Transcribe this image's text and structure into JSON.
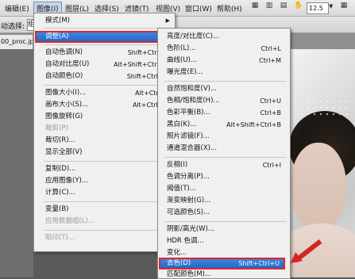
{
  "menubar": {
    "items": [
      "编辑(E)",
      "图像(I)",
      "图层(L)",
      "选择(S)",
      "滤镜(T)",
      "视图(V)",
      "窗口(W)",
      "帮助(H)"
    ],
    "zoom": "12.5"
  },
  "options": {
    "label": "动选择:",
    "select_value": "组"
  },
  "document": {
    "tab": "00_proc.jpg"
  },
  "image_menu": [
    {
      "label": "模式(M)",
      "arrow": true
    },
    {
      "label": "调整(A)",
      "arrow": true,
      "highlighted": true
    },
    {
      "label": "自动色调(N)",
      "shortcut": "Shift+Ctrl+L"
    },
    {
      "label": "自动对比度(U)",
      "shortcut": "Alt+Shift+Ctrl+L"
    },
    {
      "label": "自动颜色(O)",
      "shortcut": "Shift+Ctrl+B"
    },
    {
      "label": "图像大小(I)...",
      "shortcut": "Alt+Ctrl+I"
    },
    {
      "label": "画布大小(S)...",
      "shortcut": "Alt+Ctrl+C"
    },
    {
      "label": "图像旋转(G)",
      "arrow": true
    },
    {
      "label": "裁剪(P)",
      "disabled": true
    },
    {
      "label": "裁切(R)..."
    },
    {
      "label": "显示全部(V)"
    },
    {
      "label": "复制(D)..."
    },
    {
      "label": "应用图像(Y)..."
    },
    {
      "label": "计算(C)..."
    },
    {
      "label": "变量(B)",
      "arrow": true
    },
    {
      "label": "应用数据组(L)...",
      "disabled": true
    },
    {
      "label": "陷印(T)...",
      "disabled": true
    }
  ],
  "adjust_menu": [
    {
      "label": "亮度/对比度(C)..."
    },
    {
      "label": "色阶(L)...",
      "shortcut": "Ctrl+L"
    },
    {
      "label": "曲线(U)...",
      "shortcut": "Ctrl+M"
    },
    {
      "label": "曝光度(E)..."
    },
    {
      "label": "自然饱和度(V)..."
    },
    {
      "label": "色相/饱和度(H)...",
      "shortcut": "Ctrl+U"
    },
    {
      "label": "色彩平衡(B)...",
      "shortcut": "Ctrl+B"
    },
    {
      "label": "黑白(K)...",
      "shortcut": "Alt+Shift+Ctrl+B"
    },
    {
      "label": "照片滤镜(F)..."
    },
    {
      "label": "通道混合器(X)..."
    },
    {
      "label": "反相(I)",
      "shortcut": "Ctrl+I"
    },
    {
      "label": "色调分离(P)..."
    },
    {
      "label": "阈值(T)..."
    },
    {
      "label": "渐变映射(G)..."
    },
    {
      "label": "可选颜色(S)..."
    },
    {
      "label": "阴影/高光(W)..."
    },
    {
      "label": "HDR 色调..."
    },
    {
      "label": "变化..."
    },
    {
      "label": "去色(D)",
      "shortcut": "Shift+Ctrl+U",
      "highlighted": true
    },
    {
      "label": "匹配颜色(M)..."
    }
  ],
  "colors": {
    "highlight": "#2a6fd0",
    "annotation_red": "#e0262a"
  }
}
